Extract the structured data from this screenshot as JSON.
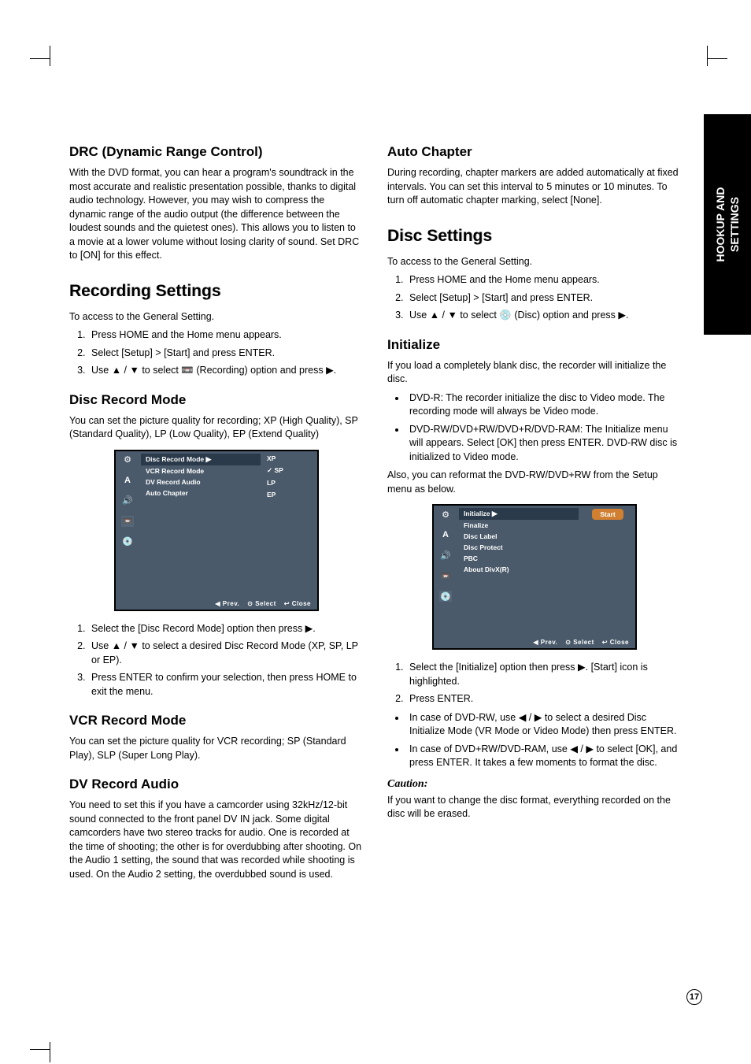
{
  "side_tab": "HOOKUP AND\nSETTINGS",
  "page_number": "17",
  "left": {
    "drc": {
      "heading": "DRC (Dynamic Range Control)",
      "body": "With the DVD format, you can hear a program's soundtrack in the most accurate and realistic presentation possible, thanks to digital audio technology. However, you may wish to compress the dynamic range of the audio output (the difference between the loudest sounds and the quietest ones). This allows you to listen to a movie at a lower volume without losing clarity of sound. Set DRC to [ON] for this effect."
    },
    "recording_settings": {
      "heading": "Recording Settings",
      "intro": "To access to the General Setting.",
      "steps": [
        "Press HOME and the Home menu appears.",
        "Select [Setup] > [Start] and press ENTER.",
        "Use ▲ / ▼ to select 📼 (Recording) option and press ▶."
      ]
    },
    "disc_record_mode": {
      "heading": "Disc Record Mode",
      "body": "You can set the picture quality for recording; XP (High Quality), SP (Standard Quality), LP (Low Quality), EP (Extend Quality)",
      "menu_items": [
        "Disc Record Mode",
        "VCR Record Mode",
        "DV Record Audio",
        "Auto Chapter"
      ],
      "right_items": [
        "XP",
        "✓ SP",
        "LP",
        "EP"
      ],
      "steps": [
        "Select the [Disc Record Mode] option then press ▶.",
        "Use ▲ / ▼ to select a desired Disc Record Mode (XP, SP, LP or EP).",
        "Press ENTER to confirm your selection, then press HOME to exit the menu."
      ]
    },
    "vcr_record_mode": {
      "heading": "VCR Record Mode",
      "body": "You can set the picture quality for VCR recording; SP (Standard Play), SLP (Super Long Play)."
    },
    "dv_record_audio": {
      "heading": "DV Record Audio",
      "body": "You need to set this if you have a camcorder using 32kHz/12-bit sound connected to the front panel DV IN jack. Some digital camcorders have two stereo tracks for audio. One is recorded at the time of shooting; the other is for overdubbing after shooting. On the Audio 1 setting, the sound that was recorded while shooting is used. On the Audio 2 setting, the overdubbed sound is used."
    }
  },
  "right": {
    "auto_chapter": {
      "heading": "Auto Chapter",
      "body": "During recording, chapter markers are added automatically at fixed intervals. You can set this interval to 5 minutes or 10 minutes. To turn off automatic chapter marking, select [None]."
    },
    "disc_settings": {
      "heading": "Disc Settings",
      "intro": "To access to the General Setting.",
      "steps": [
        "Press HOME and the Home menu appears.",
        "Select [Setup] > [Start] and press ENTER.",
        "Use ▲ / ▼ to select 💿 (Disc) option and press ▶."
      ]
    },
    "initialize": {
      "heading": "Initialize",
      "body1": "If you load a completely blank disc, the recorder will initialize the disc.",
      "bullets": [
        "DVD-R: The recorder initialize the disc to Video mode. The recording mode will always be Video mode.",
        "DVD-RW/DVD+RW/DVD+R/DVD-RAM: The Initialize menu will appears. Select [OK] then press ENTER. DVD-RW disc is initialized to Video mode."
      ],
      "body2": "Also, you can reformat the DVD-RW/DVD+RW from the Setup menu as below.",
      "menu_items": [
        "Initialize",
        "Finalize",
        "Disc Label",
        "Disc Protect",
        "PBC",
        "About DivX(R)"
      ],
      "start_btn": "Start",
      "steps": [
        "Select the [Initialize] option then press ▶. [Start] icon is highlighted.",
        "Press ENTER."
      ],
      "bullets2": [
        "In case of DVD-RW, use ◀ / ▶ to select a desired Disc Initialize Mode (VR Mode or Video Mode) then press ENTER.",
        "In case of DVD+RW/DVD-RAM, use ◀ / ▶ to select [OK], and press ENTER. It takes a few moments to format the disc."
      ],
      "caution_label": "Caution:",
      "caution_body": "If you want to change the disc format, everything recorded on the disc will be erased."
    }
  },
  "footer": {
    "prev": "◀ Prev.",
    "select": "⊙ Select",
    "close": "↩ Close"
  }
}
